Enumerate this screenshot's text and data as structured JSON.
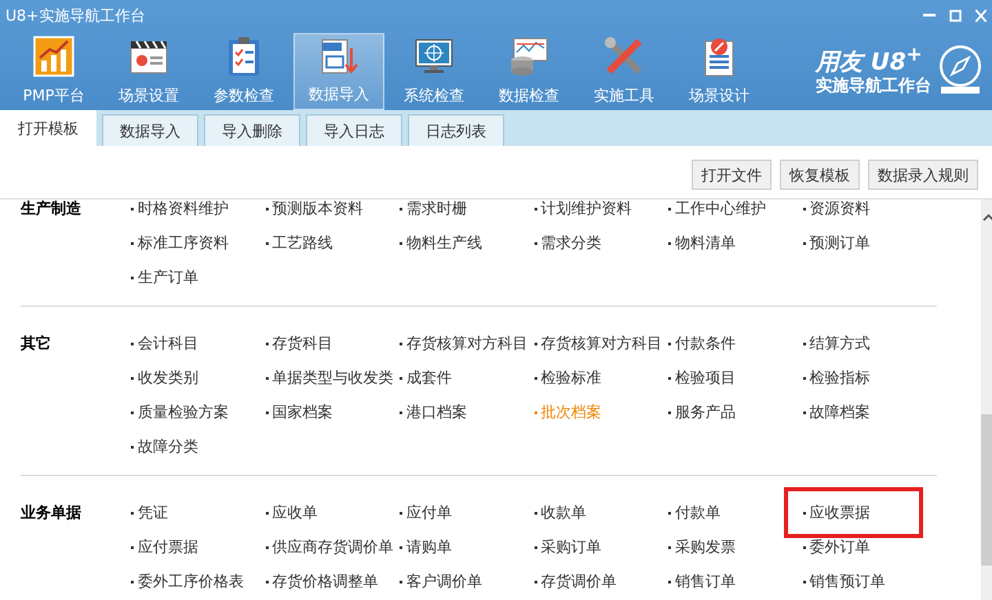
{
  "window": {
    "title": "U8+实施导航工作台"
  },
  "toolbar": [
    {
      "label": "PMP平台",
      "kind": "chart",
      "selected": false
    },
    {
      "label": "场景设置",
      "kind": "clapper",
      "selected": false
    },
    {
      "label": "参数检查",
      "kind": "clipboard",
      "selected": false
    },
    {
      "label": "数据导入",
      "kind": "file",
      "selected": true
    },
    {
      "label": "系统检查",
      "kind": "monitor",
      "selected": false
    },
    {
      "label": "数据检查",
      "kind": "database",
      "selected": false
    },
    {
      "label": "实施工具",
      "kind": "tools",
      "selected": false
    },
    {
      "label": "场景设计",
      "kind": "design",
      "selected": false
    }
  ],
  "logo": {
    "brand": "用友",
    "product": "U8",
    "sup": "+",
    "subtitle": "实施导航工作台"
  },
  "tabs": [
    {
      "label": "打开模板",
      "selected": true
    },
    {
      "label": "数据导入",
      "selected": false
    },
    {
      "label": "导入删除",
      "selected": false
    },
    {
      "label": "导入日志",
      "selected": false
    },
    {
      "label": "日志列表",
      "selected": false
    }
  ],
  "actions": [
    "打开文件",
    "恢复模板",
    "数据录入规则"
  ],
  "sections": [
    {
      "title": "生产制造",
      "items": [
        {
          "label": "时格资料维护",
          "kind": "normal"
        },
        {
          "label": "预测版本资料",
          "kind": "normal"
        },
        {
          "label": "需求时栅",
          "kind": "normal"
        },
        {
          "label": "计划维护资料",
          "kind": "normal"
        },
        {
          "label": "工作中心维护",
          "kind": "normal"
        },
        {
          "label": "资源资料",
          "kind": "normal"
        },
        {
          "label": "标准工序资料",
          "kind": "normal"
        },
        {
          "label": "工艺路线",
          "kind": "normal"
        },
        {
          "label": "物料生产线",
          "kind": "normal"
        },
        {
          "label": "需求分类",
          "kind": "normal"
        },
        {
          "label": "物料清单",
          "kind": "normal"
        },
        {
          "label": "预测订单",
          "kind": "normal"
        },
        {
          "label": "生产订单",
          "kind": "normal"
        }
      ]
    },
    {
      "title": "其它",
      "items": [
        {
          "label": "会计科目",
          "kind": "normal"
        },
        {
          "label": "存货科目",
          "kind": "normal"
        },
        {
          "label": "存货核算对方科目",
          "kind": "normal"
        },
        {
          "label": "存货核算对方科目",
          "kind": "normal"
        },
        {
          "label": "付款条件",
          "kind": "normal"
        },
        {
          "label": "结算方式",
          "kind": "normal"
        },
        {
          "label": "收发类别",
          "kind": "normal"
        },
        {
          "label": "单据类型与收发类",
          "kind": "normal"
        },
        {
          "label": "成套件",
          "kind": "normal"
        },
        {
          "label": "检验标准",
          "kind": "normal"
        },
        {
          "label": "检验项目",
          "kind": "normal"
        },
        {
          "label": "检验指标",
          "kind": "normal"
        },
        {
          "label": "质量检验方案",
          "kind": "normal"
        },
        {
          "label": "国家档案",
          "kind": "normal"
        },
        {
          "label": "港口档案",
          "kind": "normal"
        },
        {
          "label": "批次档案",
          "kind": "hover"
        },
        {
          "label": "服务产品",
          "kind": "normal"
        },
        {
          "label": "故障档案",
          "kind": "normal"
        },
        {
          "label": "故障分类",
          "kind": "normal"
        }
      ]
    },
    {
      "title": "业务单据",
      "items": [
        {
          "label": "凭证",
          "kind": "normal"
        },
        {
          "label": "应收单",
          "kind": "normal"
        },
        {
          "label": "应付单",
          "kind": "normal"
        },
        {
          "label": "收款单",
          "kind": "normal"
        },
        {
          "label": "付款单",
          "kind": "normal"
        },
        {
          "label": "应收票据",
          "kind": "boxed"
        },
        {
          "label": "应付票据",
          "kind": "normal"
        },
        {
          "label": "供应商存货调价单",
          "kind": "normal"
        },
        {
          "label": "请购单",
          "kind": "normal"
        },
        {
          "label": "采购订单",
          "kind": "normal"
        },
        {
          "label": "采购发票",
          "kind": "normal"
        },
        {
          "label": "委外订单",
          "kind": "normal"
        },
        {
          "label": "委外工序价格表",
          "kind": "normal"
        },
        {
          "label": "存货价格调整单",
          "kind": "normal"
        },
        {
          "label": "客户调价单",
          "kind": "normal"
        },
        {
          "label": "存货调价单",
          "kind": "normal"
        },
        {
          "label": "销售订单",
          "kind": "normal"
        },
        {
          "label": "销售预订单",
          "kind": "normal"
        }
      ]
    }
  ]
}
